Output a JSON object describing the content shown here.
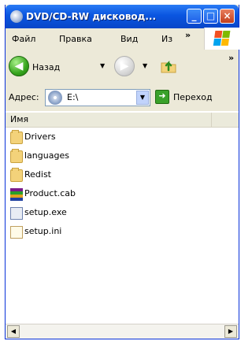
{
  "window": {
    "title": "DVD/CD-RW дисковод...",
    "icon": "cd-drive-icon",
    "controls": {
      "minimize": "_",
      "maximize": "□",
      "close": "×"
    }
  },
  "menu": {
    "items": [
      "Файл",
      "Правка",
      "Вид",
      "Из"
    ],
    "overflow": "»"
  },
  "toolbar": {
    "back_label": "Назад",
    "overflow": "»"
  },
  "address": {
    "label": "Адрес:",
    "value": "E:\\",
    "go_label": "Переход"
  },
  "list": {
    "column_name": "Имя",
    "files": [
      {
        "name": "Drivers",
        "icon": "folder-icon"
      },
      {
        "name": "languages",
        "icon": "folder-icon"
      },
      {
        "name": "Redist",
        "icon": "folder-icon"
      },
      {
        "name": "Product.cab",
        "icon": "cab-archive-icon"
      },
      {
        "name": "setup.exe",
        "icon": "setup-exe-icon"
      },
      {
        "name": "setup.ini",
        "icon": "ini-file-icon"
      }
    ]
  },
  "colors": {
    "titlebar": "#0a55e0",
    "chrome": "#ece9d8",
    "back_button": "#37a51e",
    "go_button": "#39a12a",
    "folder": "#f3d27a"
  }
}
